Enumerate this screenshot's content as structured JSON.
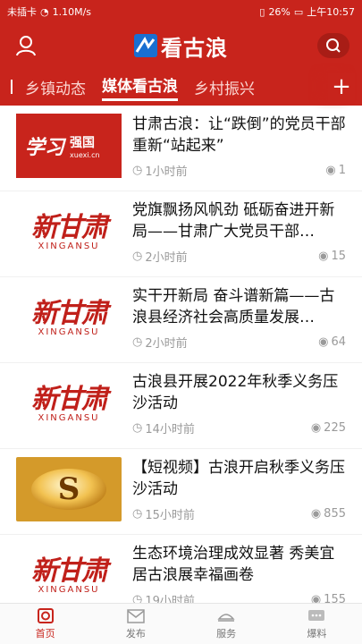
{
  "status": {
    "carrier": "未插卡",
    "speed": "1.10M/s",
    "battery": "26%",
    "time": "上午10:57"
  },
  "header": {
    "logo_text": "看古浪"
  },
  "tabs": [
    {
      "label": "乡镇动态",
      "active": false
    },
    {
      "label": "媒体看古浪",
      "active": true
    },
    {
      "label": "乡村振兴",
      "active": false
    }
  ],
  "tabs_plus": "+",
  "thumbs": {
    "xuexi_main": "学习",
    "xuexi_brand": "强国",
    "xuexi_url": "xuexi.cn",
    "xingansu_cn": "新甘肃",
    "xingansu_en": "XINGANSU",
    "video_letter": "S"
  },
  "articles": [
    {
      "title": "甘肃古浪：让“跌倒”的党员干部重新“站起来”",
      "time": "1小时前",
      "views": "1",
      "thumb": "xuexi"
    },
    {
      "title": "党旗飘扬风帆劲 砥砺奋进开新局——甘肃广大党员干部…",
      "time": "2小时前",
      "views": "15",
      "thumb": "xingansu"
    },
    {
      "title": "实干开新局 奋斗谱新篇——古浪县经济社会高质量发展…",
      "time": "2小时前",
      "views": "64",
      "thumb": "xingansu"
    },
    {
      "title": "古浪县开展2022年秋季义务压沙活动",
      "time": "14小时前",
      "views": "225",
      "thumb": "xingansu"
    },
    {
      "title": "【短视频】古浪开启秋季义务压沙活动",
      "time": "15小时前",
      "views": "855",
      "thumb": "video"
    },
    {
      "title": "生态环境治理成效显著 秀美宜居古浪展幸福画卷",
      "time": "19小时前",
      "views": "155",
      "thumb": "xingansu"
    }
  ],
  "bottom_nav": [
    {
      "label": "首页",
      "icon": "home-icon",
      "active": true
    },
    {
      "label": "发布",
      "icon": "mail-icon",
      "active": false
    },
    {
      "label": "服务",
      "icon": "service-icon",
      "active": false
    },
    {
      "label": "爆料",
      "icon": "chat-icon",
      "active": false
    }
  ],
  "colors": {
    "brand_red": "#c8241c",
    "logo_blue": "#1a6fd1"
  }
}
